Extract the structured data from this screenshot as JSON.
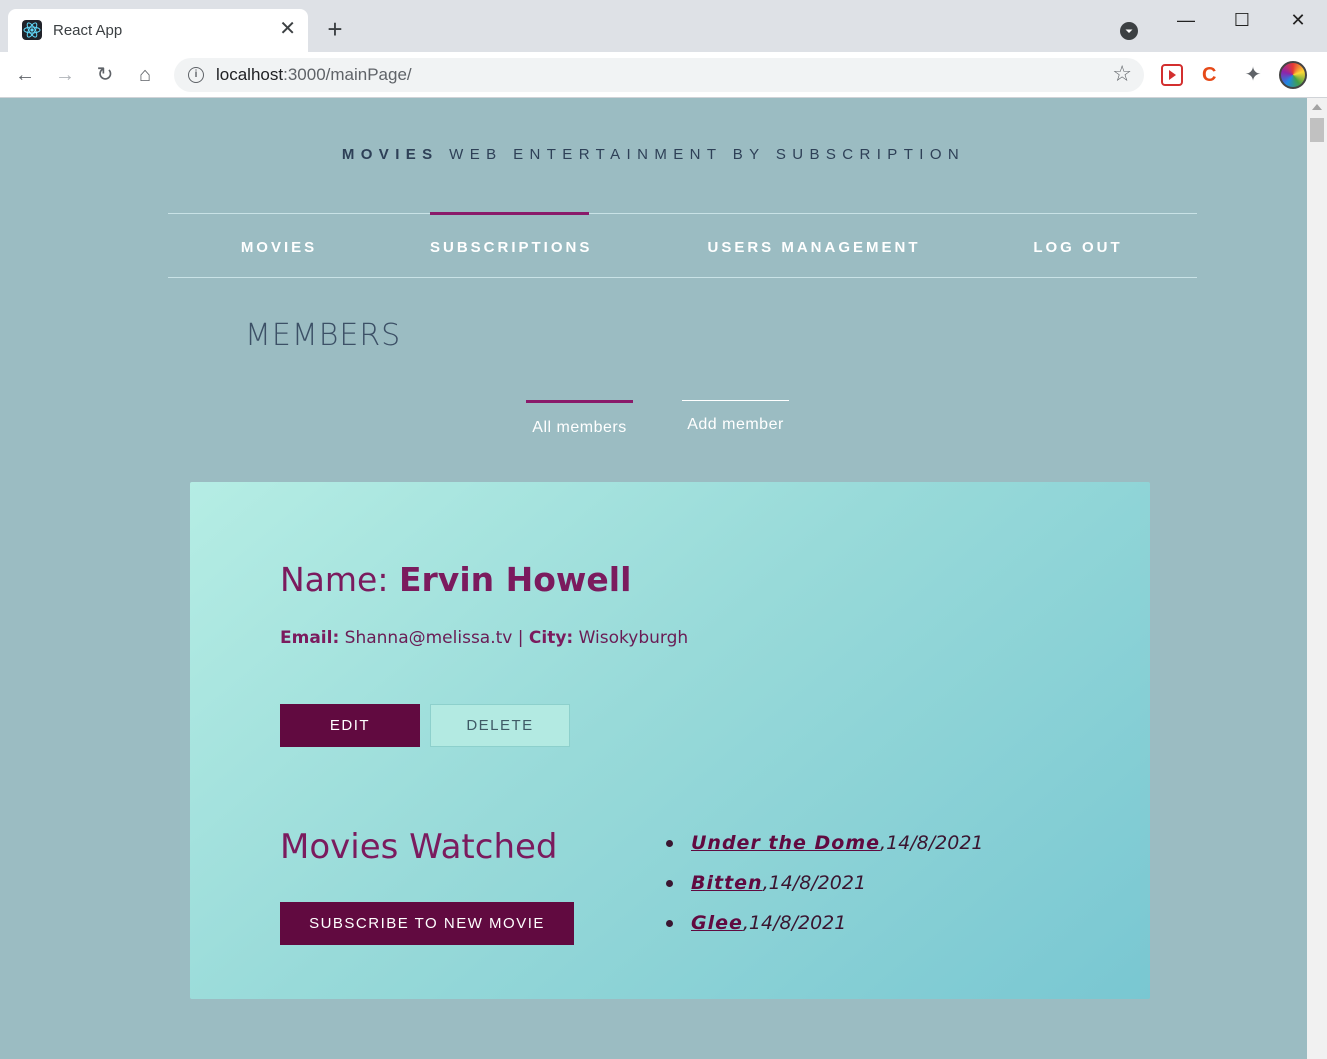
{
  "browser": {
    "tab_title": "React App",
    "url_host": "localhost",
    "url_path": ":3000/mainPage/"
  },
  "site": {
    "title_bold": "MOVIES",
    "title_rest": "WEB ENTERTAINMENT BY SUBSCRIPTION"
  },
  "mainnav": {
    "items": [
      {
        "label": "MOVIES"
      },
      {
        "label": "SUBSCRIPTIONS",
        "active": true
      },
      {
        "label": "USERS MANAGEMENT"
      },
      {
        "label": "LOG OUT"
      }
    ]
  },
  "section": {
    "title": "MEMBERS"
  },
  "subtabs": {
    "all_members": "All members",
    "add_member": "Add member"
  },
  "member": {
    "name_label": "Name:",
    "name": "Ervin Howell",
    "email_label": "Email:",
    "email": "Shanna@melissa.tv",
    "separator": "|",
    "city_label": "City:",
    "city": "Wisokyburgh",
    "edit_label": "EDIT",
    "delete_label": "DELETE",
    "watched_title": "Movies Watched",
    "subscribe_label": "SUBSCRIBE TO NEW MOVIE",
    "movies": [
      {
        "title": "Under the Dome",
        "date": ",14/8/2021"
      },
      {
        "title": "Bitten",
        "date": ",14/8/2021"
      },
      {
        "title": "Glee",
        "date": ",14/8/2021"
      }
    ]
  },
  "colors": {
    "page_bg": "#9bbcc2",
    "accent": "#610a40",
    "active_underline": "#8a1a6a",
    "text_purple": "#7b1b5e"
  }
}
